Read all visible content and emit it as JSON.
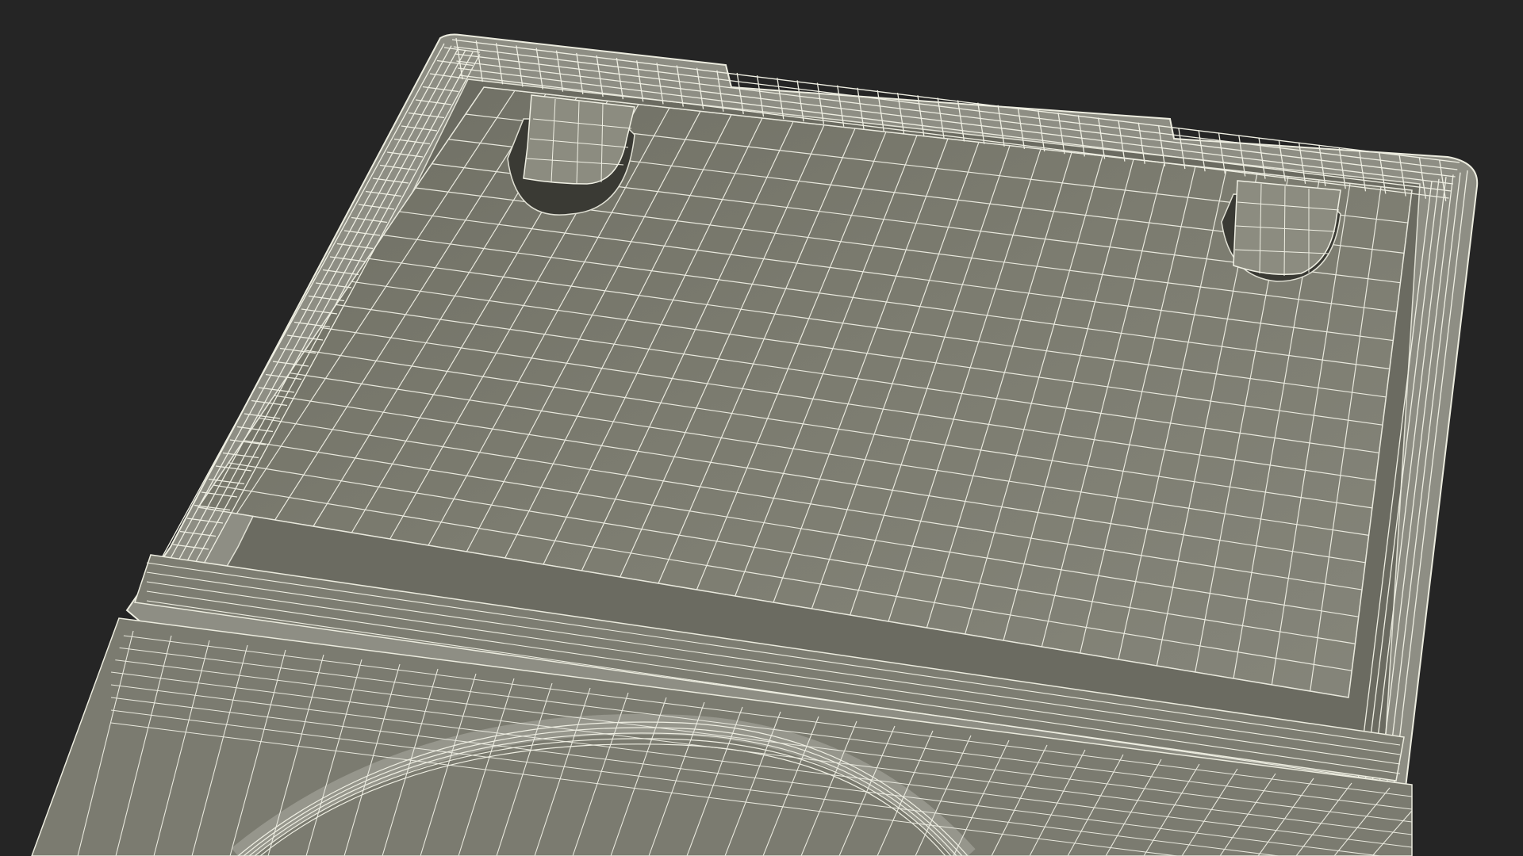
{
  "scene": {
    "subject": "wireframe-dvd-case-tray",
    "colors": {
      "background": "#252525",
      "surface": "#7a7a6e",
      "surface_shadow": "#5e5e54",
      "wall": "#8b8b80",
      "wire": "#e9e9de",
      "slot": "#3a3a34"
    }
  }
}
